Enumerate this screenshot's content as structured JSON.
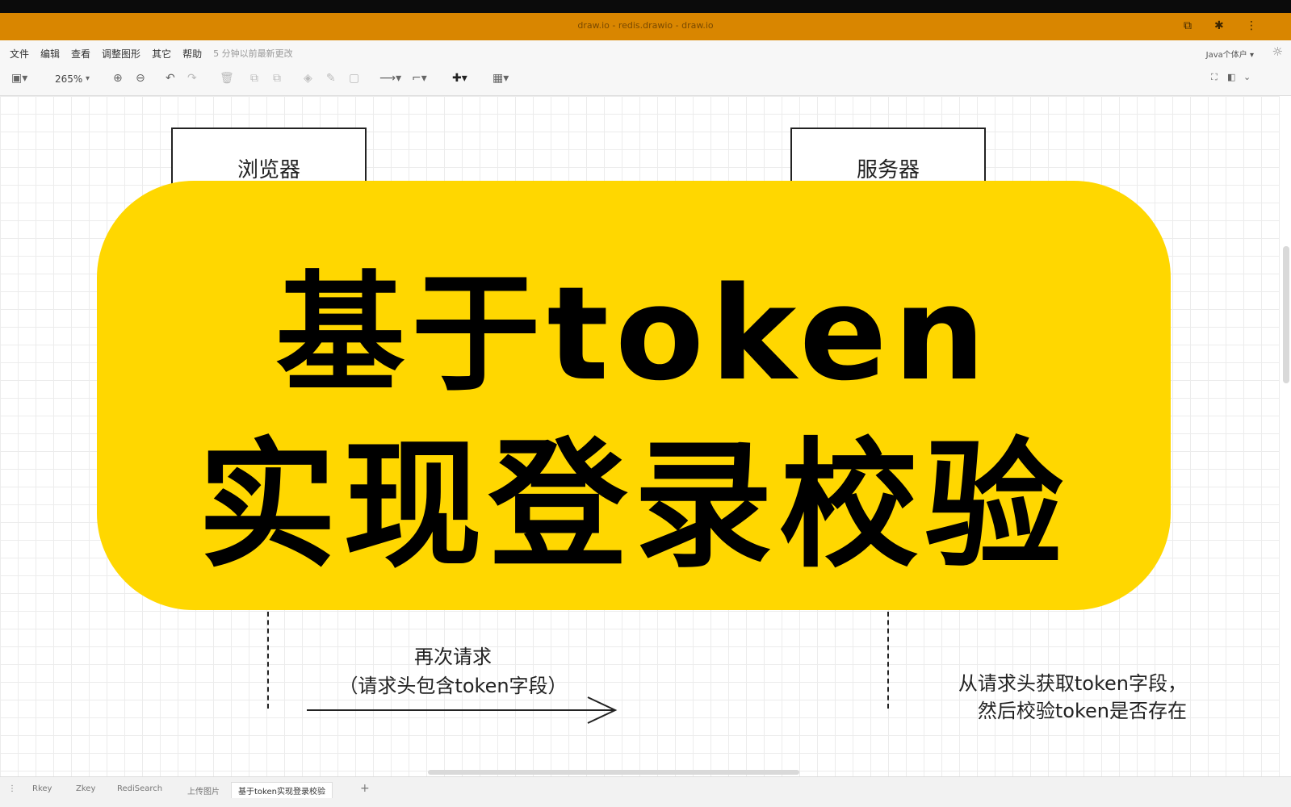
{
  "window": {
    "title": "draw.io - redis.drawio - draw.io"
  },
  "menu": {
    "items": [
      "文件",
      "编辑",
      "查看",
      "调整图形",
      "其它",
      "帮助"
    ],
    "hint": "5 分钟以前最新更改",
    "account": "Java个体户 ▾"
  },
  "toolbar": {
    "zoom": "265%"
  },
  "diagram": {
    "browser_label": "浏览器",
    "server_label": "服务器",
    "request_line1": "再次请求",
    "request_line2": "（请求头包含token字段）",
    "server_note_line1": "从请求头获取token字段，",
    "server_note_line2": "然后校验token是否存在"
  },
  "overlay": {
    "line1": "基于token",
    "line2": "实现登录校验",
    "color": "#ffd700"
  },
  "tabs": [
    "Rkey",
    "Zkey",
    "RediSearch",
    "上传图片",
    "基于token实现登录校验"
  ],
  "colors": {
    "titlebar": "#d98600",
    "overlay": "#ffd700"
  }
}
